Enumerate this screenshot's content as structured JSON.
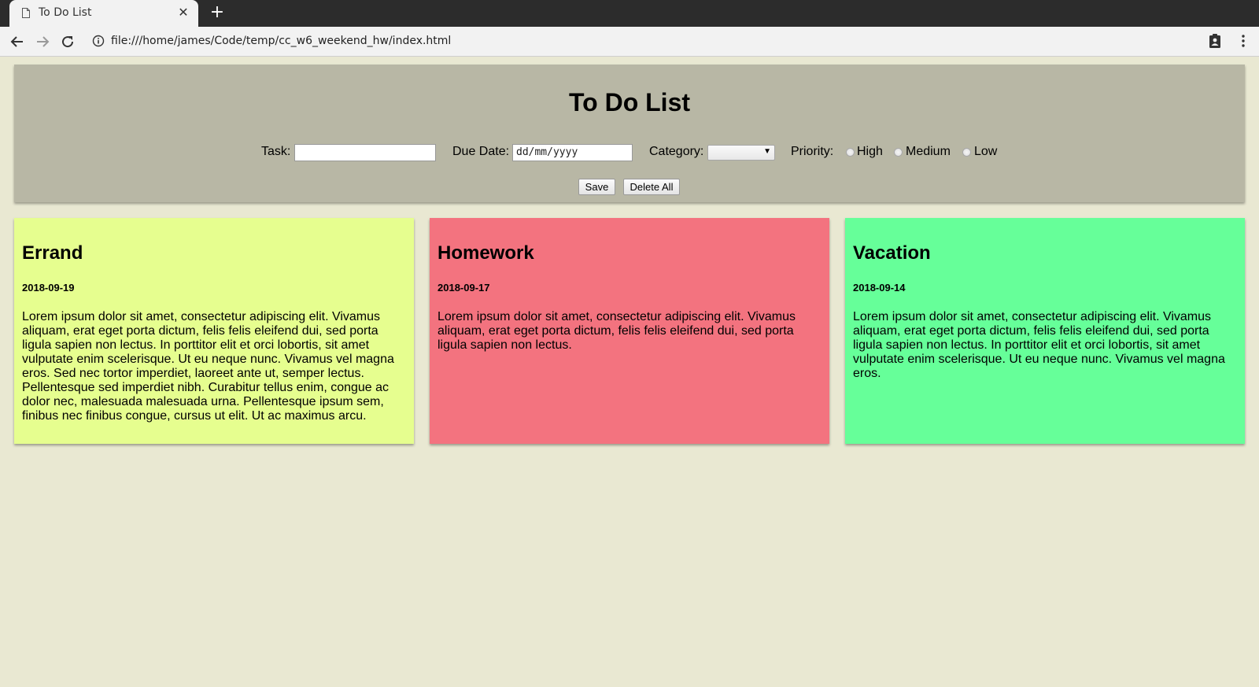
{
  "browser": {
    "tab_title": "To Do List",
    "url": "file:///home/james/Code/temp/cc_w6_weekend_hw/index.html"
  },
  "header": {
    "title": "To Do List"
  },
  "form": {
    "task_label": "Task:",
    "task_value": "",
    "due_date_label": "Due Date:",
    "due_date_placeholder": "dd/mm/yyyy",
    "category_label": "Category:",
    "category_value": "",
    "priority_label": "Priority:",
    "priority_options": [
      "High",
      "Medium",
      "Low"
    ],
    "save_label": "Save",
    "delete_all_label": "Delete All"
  },
  "cards": [
    {
      "title": "Errand",
      "date": "2018-09-19",
      "body": "Lorem ipsum dolor sit amet, consectetur adipiscing elit. Vivamus aliquam, erat eget porta dictum, felis felis eleifend dui, sed porta ligula sapien non lectus. In porttitor elit et orci lobortis, sit amet vulputate enim scelerisque. Ut eu neque nunc. Vivamus vel magna eros. Sed nec tortor imperdiet, laoreet ante ut, semper lectus. Pellentesque sed imperdiet nibh. Curabitur tellus enim, congue ac dolor nec, malesuada malesuada urna. Pellentesque ipsum sem, finibus nec finibus congue, cursus ut elit. Ut ac maximus arcu.",
      "color": "#e6fe8f"
    },
    {
      "title": "Homework",
      "date": "2018-09-17",
      "body": "Lorem ipsum dolor sit amet, consectetur adipiscing elit. Vivamus aliquam, erat eget porta dictum, felis felis eleifend dui, sed porta ligula sapien non lectus.",
      "color": "#f3737f"
    },
    {
      "title": "Vacation",
      "date": "2018-09-14",
      "body": "Lorem ipsum dolor sit amet, consectetur adipiscing elit. Vivamus aliquam, erat eget porta dictum, felis felis eleifend dui, sed porta ligula sapien non lectus. In porttitor elit et orci lobortis, sit amet vulputate enim scelerisque. Ut eu neque nunc. Vivamus vel magna eros.",
      "color": "#66ff99"
    }
  ],
  "colors": {
    "page_background": "#e9e8d2",
    "header_background": "#b8b7a5"
  },
  "icons": {
    "tab": "page-icon",
    "close": "close-icon",
    "new_tab": "plus-icon",
    "back": "arrow-left-icon",
    "forward": "arrow-right-icon",
    "reload": "reload-icon",
    "site_info": "info-icon",
    "extension": "clipboard-person-icon",
    "menu": "kebab-menu-icon"
  }
}
